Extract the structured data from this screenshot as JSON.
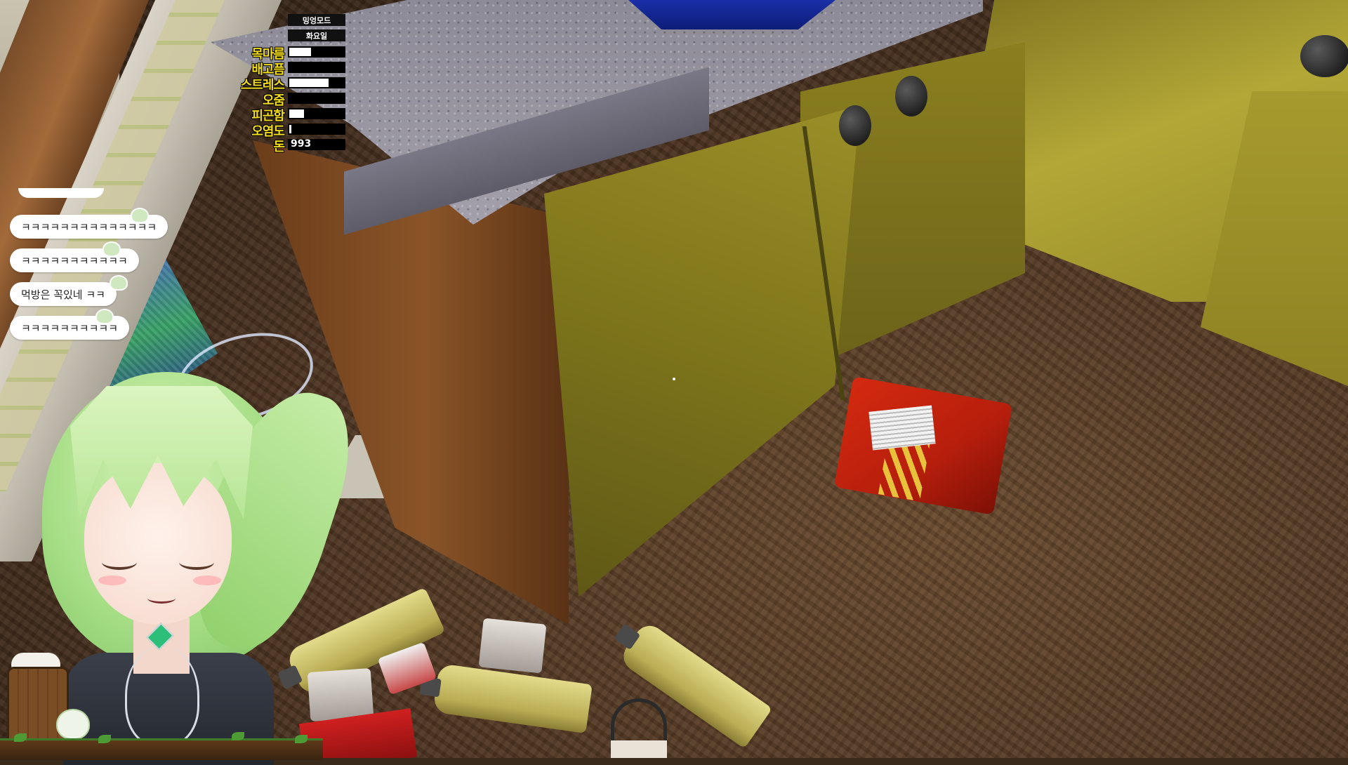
{
  "hud": {
    "mode_label": "밍엉모드",
    "day_label": "화요일",
    "stats": [
      {
        "label": "목마름",
        "level": 0.4
      },
      {
        "label": "배고픔",
        "level": 0.0
      },
      {
        "label": "스트레스",
        "level": 0.72
      },
      {
        "label": "오줌",
        "level": 0.0
      },
      {
        "label": "피곤함",
        "level": 0.27
      },
      {
        "label": "오염도",
        "level": 0.04
      }
    ],
    "money_label": "돈",
    "money_value": "993"
  },
  "chat": {
    "messages": [
      {
        "text": "ㅋㅋㅋㅋㅋㅋㅋㅋㅋㅋㅋㅋㅋㅋ"
      },
      {
        "text": "ㅋㅋㅋㅋㅋㅋㅋㅋㅋㅋㅋ"
      },
      {
        "text": "먹방은 꼭있네 ㅋㅋ"
      },
      {
        "text": "ㅋㅋㅋㅋㅋㅋㅋㅋㅋㅋ"
      }
    ]
  },
  "colors": {
    "stat_label": "#f2dc1c",
    "bar_bg": "#000000",
    "bar_fill": "#ffffff",
    "cabinet": "#9a8f28",
    "avatar_hair": "#b6e595"
  },
  "icons": {
    "crosshair": "crosshair-icon",
    "chat_deco": "mascot-icon",
    "barrel": "barrel-icon"
  }
}
